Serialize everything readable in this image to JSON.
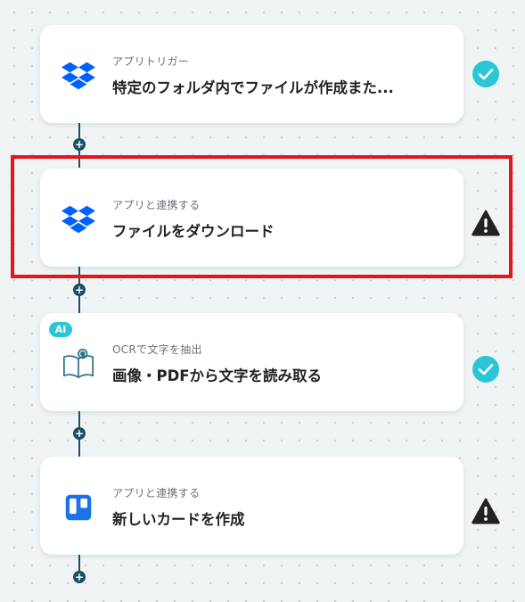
{
  "flow": {
    "steps": [
      {
        "subtitle": "アプリトリガー",
        "title": "特定のフォルダ内でファイルが作成また...",
        "app_icon": "dropbox-icon",
        "status": "success-check-icon"
      },
      {
        "subtitle": "アプリと連携する",
        "title": "ファイルをダウンロード",
        "app_icon": "dropbox-icon",
        "status": "warning-icon"
      },
      {
        "subtitle": "OCRで文字を抽出",
        "title": "画像・PDFから文字を読み取る",
        "app_icon": "book-ocr-icon",
        "badge": "AI",
        "status": "success-check-icon"
      },
      {
        "subtitle": "アプリと連携する",
        "title": "新しいカードを作成",
        "app_icon": "trello-icon",
        "status": "warning-icon"
      }
    ],
    "add_step_label": "+"
  },
  "colors": {
    "connector": "#1a4f66",
    "success": "#2bc6d6",
    "warning": "#222222",
    "highlight": "#e3161c",
    "dropbox": "#0061fe",
    "trello": "#1a73e8"
  }
}
